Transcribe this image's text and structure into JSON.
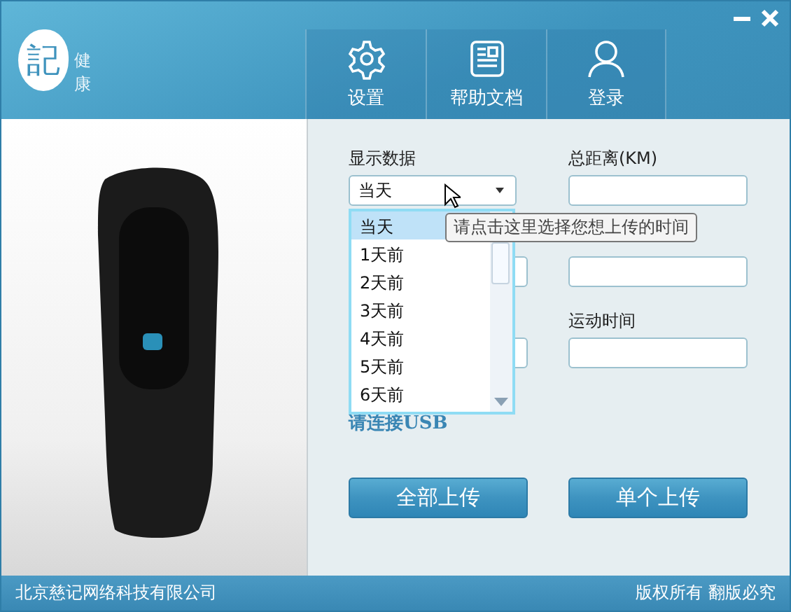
{
  "header": {
    "logo": "記",
    "app_name": "健康",
    "nav": [
      {
        "label": "设置"
      },
      {
        "label": "帮助文档"
      },
      {
        "label": "登录"
      }
    ]
  },
  "form": {
    "date_label": "显示数据",
    "date_value": "当天",
    "fields": [
      {
        "label": "总距离(KM)"
      },
      {
        "label": "运动时间"
      }
    ],
    "dropdown": {
      "options": [
        {
          "label": "当天",
          "selected": true
        },
        {
          "label": "1天前",
          "selected": false
        },
        {
          "label": "2天前",
          "selected": false
        },
        {
          "label": "3天前",
          "selected": false
        },
        {
          "label": "4天前",
          "selected": false
        },
        {
          "label": "5天前",
          "selected": false
        },
        {
          "label": "6天前",
          "selected": false
        }
      ]
    },
    "tooltip": "请点击这里选择您想上传的时间",
    "status": "请连接USB",
    "buttons": [
      "全部上传",
      "单个上传"
    ]
  },
  "footer": {
    "company": "北京慈记网络科技有限公司",
    "rights": "版权所有 翻版必究"
  }
}
